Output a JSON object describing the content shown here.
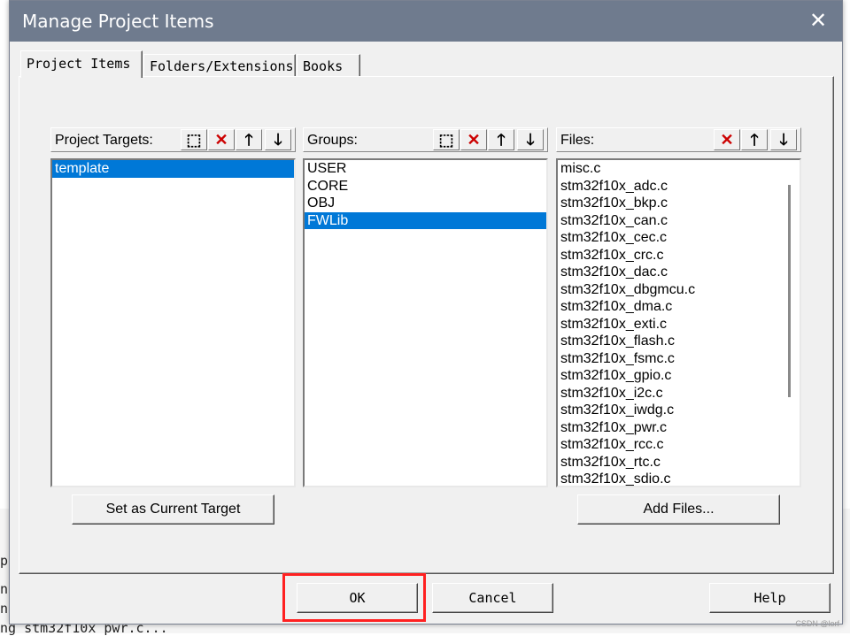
{
  "window": {
    "title": "Manage Project Items",
    "close_label": "✕"
  },
  "tabs": [
    "Project Items",
    "Folders/Extensions",
    "Books"
  ],
  "targets": {
    "label": "Project Targets:",
    "items": [
      "template"
    ],
    "selected_index": 0,
    "set_current_label": "Set as Current Target"
  },
  "groups": {
    "label": "Groups:",
    "items": [
      "USER",
      "CORE",
      "OBJ",
      "FWLib"
    ],
    "selected_index": 3
  },
  "files": {
    "label": "Files:",
    "items": [
      "misc.c",
      "stm32f10x_adc.c",
      "stm32f10x_bkp.c",
      "stm32f10x_can.c",
      "stm32f10x_cec.c",
      "stm32f10x_crc.c",
      "stm32f10x_dac.c",
      "stm32f10x_dbgmcu.c",
      "stm32f10x_dma.c",
      "stm32f10x_exti.c",
      "stm32f10x_flash.c",
      "stm32f10x_fsmc.c",
      "stm32f10x_gpio.c",
      "stm32f10x_i2c.c",
      "stm32f10x_iwdg.c",
      "stm32f10x_pwr.c",
      "stm32f10x_rcc.c",
      "stm32f10x_rtc.c",
      "stm32f10x_sdio.c"
    ],
    "add_files_label": "Add Files..."
  },
  "footer": {
    "ok_label": "OK",
    "cancel_label": "Cancel",
    "help_label": "Help"
  },
  "background": {
    "line1": "np",
    "line2": "np",
    "line3": "ng stm32f10x pwr.c...",
    "side": "pc"
  },
  "watermark": "CSDN @lorf",
  "colors": {
    "titlebar": "#6f7b8e",
    "selection": "#0078d7",
    "highlight": "#ff2020",
    "delete": "#cc0000"
  }
}
